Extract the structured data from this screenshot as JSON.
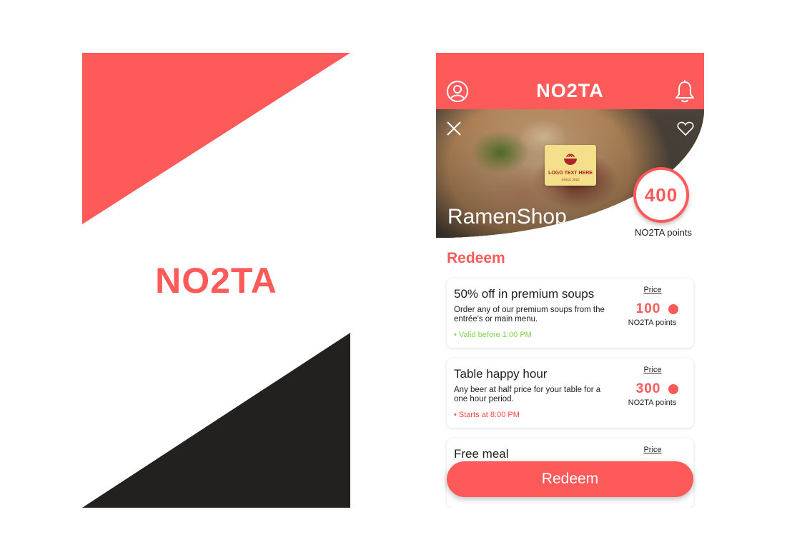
{
  "splash": {
    "brand": "NO2TA",
    "colors": {
      "accent": "#ff5a5a",
      "dark": "#232120"
    }
  },
  "header": {
    "logo": "NO2TA",
    "profile_icon": "user-circle-icon",
    "notification_icon": "bell-icon"
  },
  "restaurant": {
    "name": "RamenShop",
    "logo_text": "LOGO TEXT HERE",
    "logo_subtext": "SINCE 2020",
    "points": "400",
    "points_label": "NO2TA points",
    "close_icon": "close-icon",
    "favorite_icon": "heart-icon"
  },
  "section_title": "Redeem",
  "offers": [
    {
      "title": "50% off in premium soups",
      "description": "Order any of our premium soups from the entrée's or main menu.",
      "validity": "• Valid before 1:00 PM",
      "validity_color": "#7fd34b",
      "price_label": "Price",
      "price": "100",
      "price_unit": "NO2TA points"
    },
    {
      "title": "Table happy hour",
      "description": "Any beer at half price for your table for a one hour period.",
      "validity": "• Starts at 8:00 PM",
      "validity_color": "#ff4a4a",
      "price_label": "Price",
      "price": "300",
      "price_unit": "NO2TA points"
    },
    {
      "title": "Free meal",
      "price_label": "Price"
    }
  ],
  "redeem_button": "Redeem",
  "colors": {
    "accent": "#ff5a5a",
    "valid_green": "#7fd34b",
    "warning_red": "#ff4a4a"
  }
}
